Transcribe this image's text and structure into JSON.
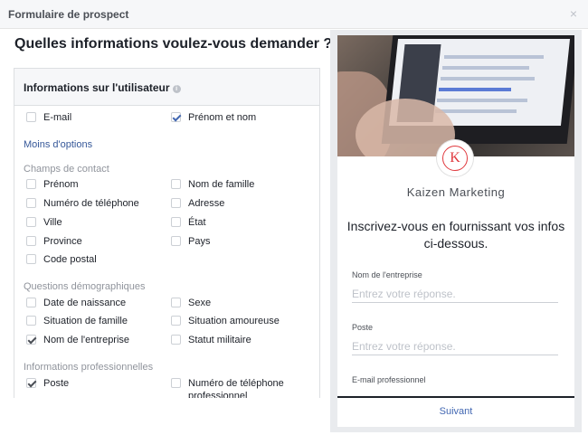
{
  "dialog": {
    "title": "Formulaire de prospect",
    "close_icon": "×"
  },
  "question": "Quelles informations voulez-vous demander ?",
  "panel": {
    "header": "Informations sur l'utilisateur",
    "info_icon": "i",
    "top_options": [
      {
        "label": "E-mail",
        "checked": false
      },
      {
        "label": "Prénom et nom",
        "checked": true
      }
    ],
    "less_options_link": "Moins d'options",
    "contact_section": "Champs de contact",
    "contact_options": [
      {
        "label": "Prénom",
        "checked": false
      },
      {
        "label": "Nom de famille",
        "checked": false
      },
      {
        "label": "Numéro de téléphone",
        "checked": false
      },
      {
        "label": "Adresse",
        "checked": false
      },
      {
        "label": "Ville",
        "checked": false
      },
      {
        "label": "État",
        "checked": false
      },
      {
        "label": "Province",
        "checked": false
      },
      {
        "label": "Pays",
        "checked": false
      },
      {
        "label": "Code postal",
        "checked": false
      }
    ],
    "demo_section": "Questions démographiques",
    "demo_options": [
      {
        "label": "Date de naissance",
        "checked": false
      },
      {
        "label": "Sexe",
        "checked": false
      },
      {
        "label": "Situation de famille",
        "checked": false
      },
      {
        "label": "Situation amoureuse",
        "checked": false
      },
      {
        "label": "Nom de l'entreprise",
        "checked": true
      },
      {
        "label": "Statut militaire",
        "checked": false
      }
    ],
    "pro_section": "Informations professionnelles",
    "pro_options": [
      {
        "label": "Poste",
        "checked": true
      },
      {
        "label": "Numéro de téléphone professionnel",
        "checked": false
      }
    ]
  },
  "preview": {
    "logo_letter": "K",
    "brand": "Kaizen Marketing",
    "headline": "Inscrivez-vous en fournissant vos infos ci-dessous.",
    "fields": [
      {
        "label": "Nom de l'entreprise",
        "placeholder": "Entrez votre réponse."
      },
      {
        "label": "Poste",
        "placeholder": "Entrez votre réponse."
      },
      {
        "label": "E-mail professionnel",
        "placeholder": ""
      }
    ],
    "next_button": "Suivant"
  },
  "colors": {
    "link": "#365899",
    "check": "#4267b2",
    "logo_red": "#e0393e"
  }
}
